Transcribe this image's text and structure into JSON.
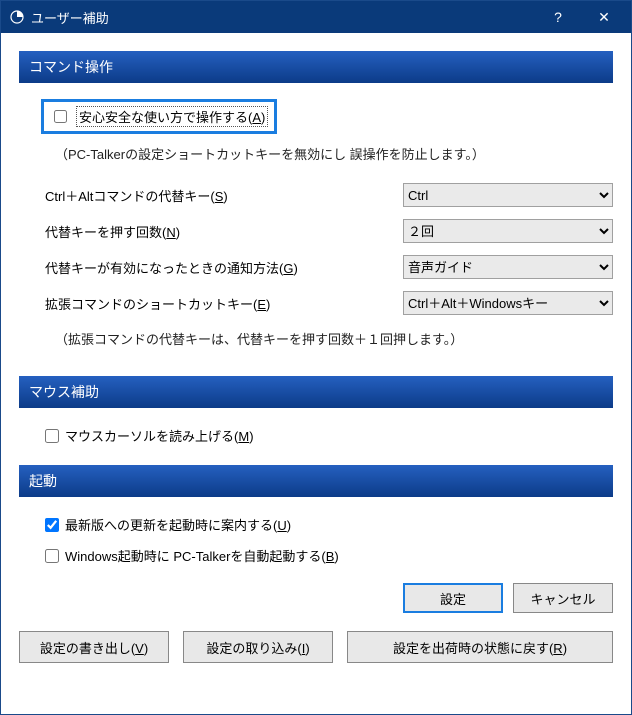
{
  "titlebar": {
    "title": "ユーザー補助",
    "help": "?",
    "close": "✕"
  },
  "section1": {
    "header": "コマンド操作",
    "safe_mode": {
      "label": "安心安全な使い方で操作する(A)",
      "checked": false
    },
    "help1": "（PC-Talkerの設定ショートカットキーを無効にし 誤操作を防止します。）",
    "alt_key": {
      "label": "Ctrl＋Altコマンドの代替キー(S)",
      "options": [
        "Ctrl"
      ],
      "selected": "Ctrl"
    },
    "count": {
      "label": "代替キーを押す回数(N)",
      "options": [
        "２回"
      ],
      "selected": "２回"
    },
    "notify": {
      "label": "代替キーが有効になったときの通知方法(G)",
      "options": [
        "音声ガイド"
      ],
      "selected": "音声ガイド"
    },
    "ext_key": {
      "label": "拡張コマンドのショートカットキー(E)",
      "options": [
        "Ctrl＋Alt＋Windowsキー"
      ],
      "selected": "Ctrl＋Alt＋Windowsキー"
    },
    "help2": "（拡張コマンドの代替キーは、代替キーを押す回数＋１回押します。）"
  },
  "section2": {
    "header": "マウス補助",
    "read_cursor": {
      "label": "マウスカーソルを読み上げる(M)",
      "checked": false
    }
  },
  "section3": {
    "header": "起動",
    "update_guide": {
      "label": "最新版への更新を起動時に案内する(U)",
      "checked": true
    },
    "autostart": {
      "label": "Windows起動時に PC-Talkerを自動起動する(B)",
      "checked": false
    }
  },
  "buttons": {
    "apply": "設定",
    "cancel": "キャンセル",
    "export": "設定の書き出し(V)",
    "import": "設定の取り込み(I)",
    "reset": "設定を出荷時の状態に戻す(R)"
  }
}
